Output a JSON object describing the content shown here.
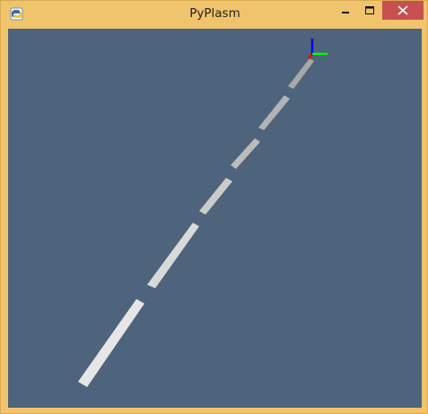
{
  "window": {
    "title": "PyPlasm",
    "controls": {
      "minimize_icon": "minimize-icon",
      "maximize_icon": "maximize-icon",
      "close_icon": "close-icon"
    },
    "app_icon": "python-icon"
  },
  "viewport": {
    "background_color": "#4d647c",
    "axes": {
      "x_color": "#00ff00",
      "y_color": "#0000ff",
      "z_color": "#ff0000"
    },
    "segment_colors": {
      "near": "#e6e6e6",
      "far": "#a8a8a8"
    }
  }
}
